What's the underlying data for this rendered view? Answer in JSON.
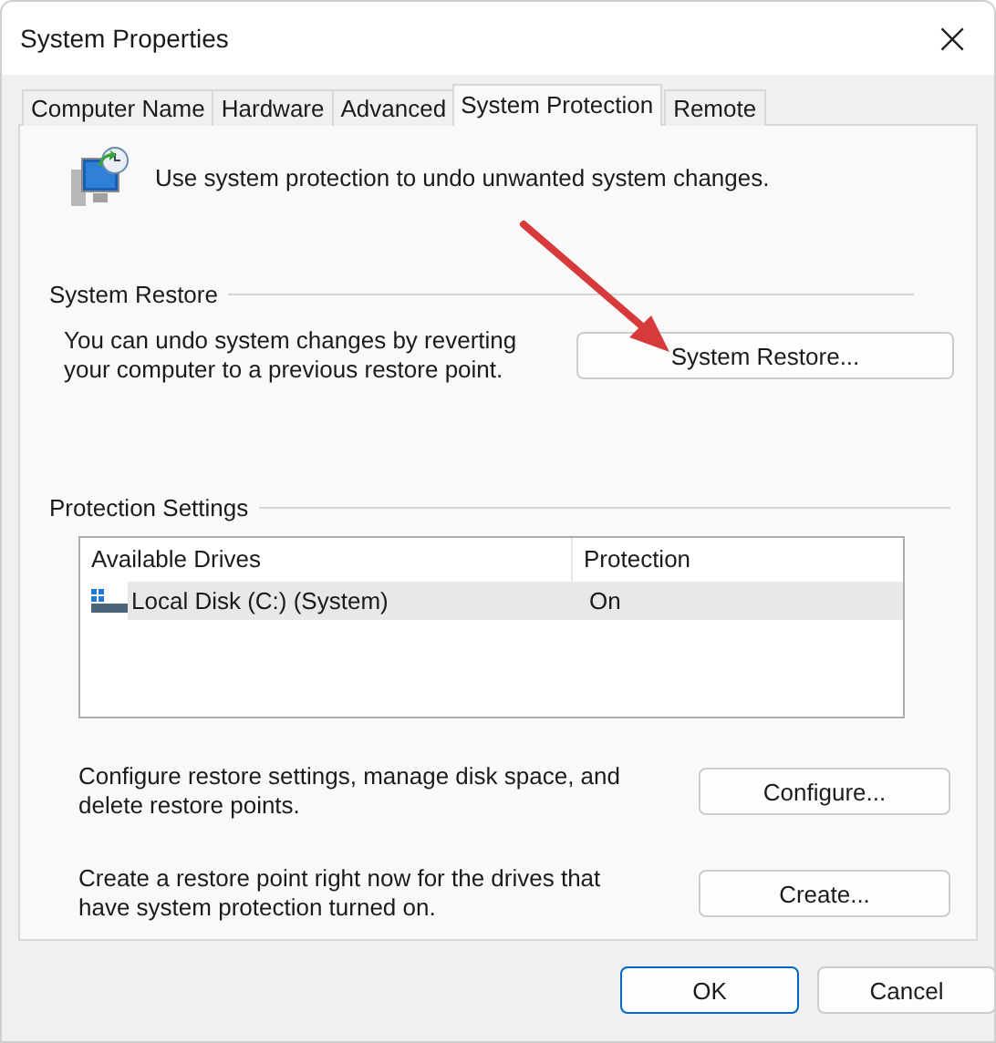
{
  "window": {
    "title": "System Properties",
    "close": "×"
  },
  "tabs": [
    {
      "label": "Computer Name",
      "selected": false
    },
    {
      "label": "Hardware",
      "selected": false
    },
    {
      "label": "Advanced",
      "selected": false
    },
    {
      "label": "System Protection",
      "selected": true
    },
    {
      "label": "Remote",
      "selected": false
    }
  ],
  "intro": "Use system protection to undo unwanted system changes.",
  "system_restore": {
    "heading": "System Restore",
    "text": "You can undo system changes by reverting your computer to a previous restore point.",
    "button": "System Restore..."
  },
  "protection_settings": {
    "heading": "Protection Settings",
    "table": {
      "columns": [
        "Available Drives",
        "Protection"
      ],
      "rows": [
        {
          "drive": "Local Disk (C:) (System)",
          "protection": "On",
          "selected": true
        }
      ]
    },
    "actions": [
      {
        "text": "Configure restore settings, manage disk space, and delete restore points.",
        "button": "Configure..."
      },
      {
        "text": "Create a restore point right now for the drives that have system protection turned on.",
        "button": "Create..."
      }
    ]
  },
  "buttons": [
    {
      "label": "OK",
      "default": true
    },
    {
      "label": "Cancel",
      "default": false
    }
  ]
}
